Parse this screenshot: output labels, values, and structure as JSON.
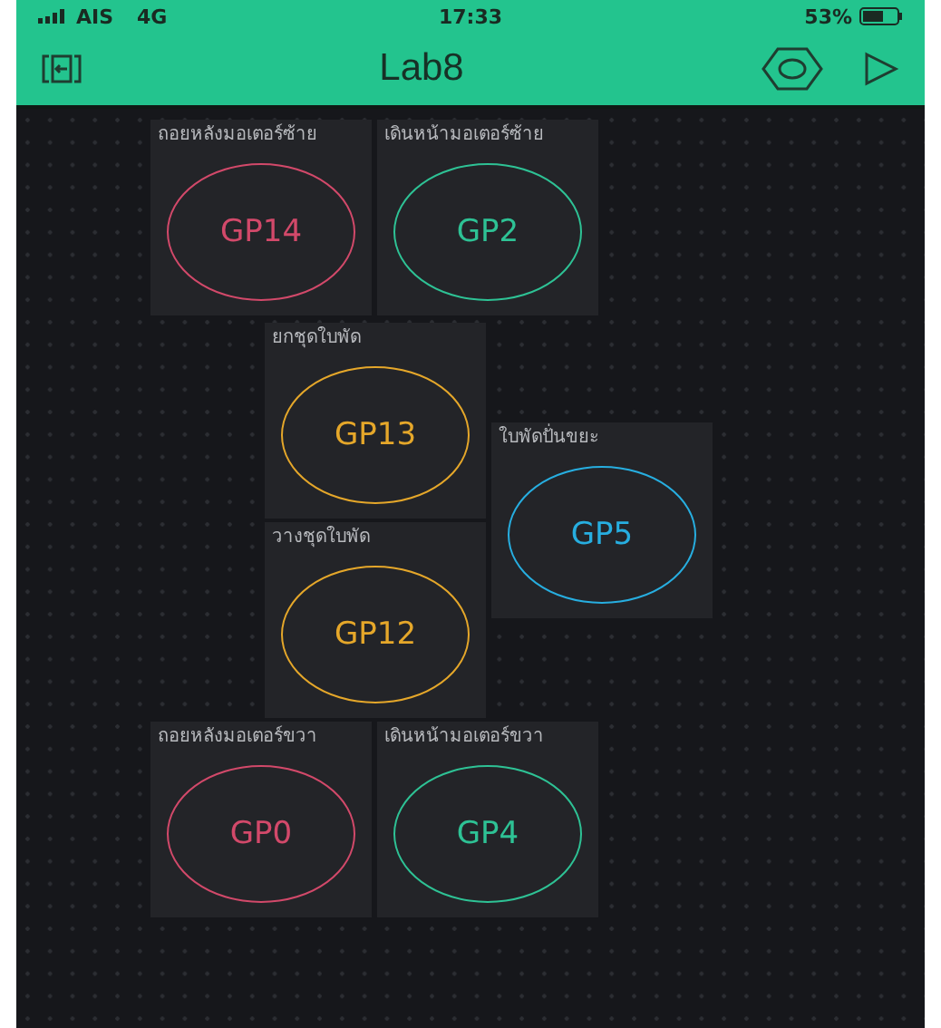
{
  "status_bar": {
    "carrier": "AIS",
    "network": "4G",
    "time": "17:33",
    "battery": "53%"
  },
  "header": {
    "title": "Lab8"
  },
  "widgets": [
    {
      "label": "ถอยหลังมอเตอร์ซ้าย",
      "pin": "GP14",
      "color": "#d2496a"
    },
    {
      "label": "เดินหน้ามอเตอร์ซ้าย",
      "pin": "GP2",
      "color": "#2ec295"
    },
    {
      "label": "ยกชุดใบพัด",
      "pin": "GP13",
      "color": "#e5a72a"
    },
    {
      "label": "ใบพัดปั่นขยะ",
      "pin": "GP5",
      "color": "#27aee0"
    },
    {
      "label": "วางชุดใบพัด",
      "pin": "GP12",
      "color": "#e5a72a"
    },
    {
      "label": "ถอยหลังมอเตอร์ขวา",
      "pin": "GP0",
      "color": "#d2496a"
    },
    {
      "label": "เดินหน้ามอเตอร์ขวา",
      "pin": "GP4",
      "color": "#2ec295"
    }
  ]
}
